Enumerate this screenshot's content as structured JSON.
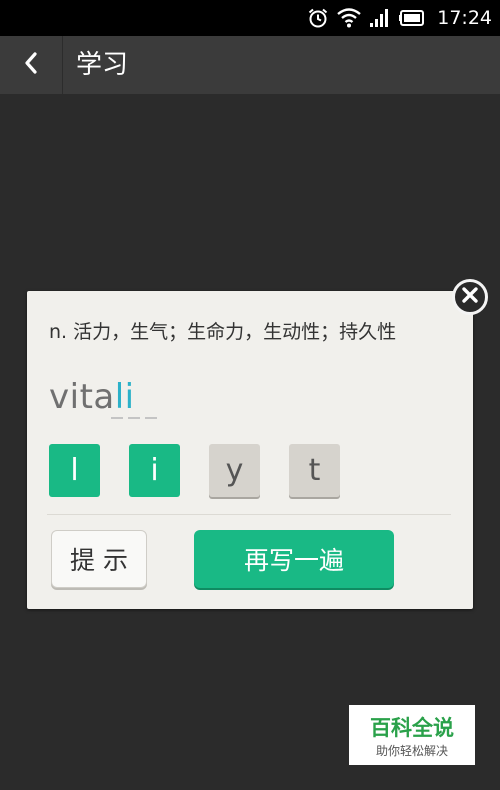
{
  "status_bar": {
    "time": "17:24",
    "icons": [
      "alarm-icon",
      "wifi-icon",
      "signal-icon",
      "battery-icon"
    ]
  },
  "app_bar": {
    "back_icon": "chevron-left-icon",
    "title": "学习"
  },
  "dialog": {
    "definition": "n. 活力，生气；生命力，生动性；持久性",
    "word_prefix": "vita",
    "word_typed": "li",
    "blank_count": 3,
    "letter_tiles": [
      {
        "letter": "l",
        "state": "used"
      },
      {
        "letter": "i",
        "state": "used"
      },
      {
        "letter": "y",
        "state": "available"
      },
      {
        "letter": "t",
        "state": "available"
      }
    ],
    "hint_label": "提示",
    "rewrite_label": "再写一遍",
    "close_icon": "close-circle-icon"
  },
  "watermark": {
    "main": "百科全说",
    "sub": "助你轻松解决"
  },
  "colors": {
    "accent_green": "#19b985",
    "typed_blue": "#2cb1c9",
    "background": "#2b2b2b",
    "app_bar": "#3b3b3b"
  }
}
